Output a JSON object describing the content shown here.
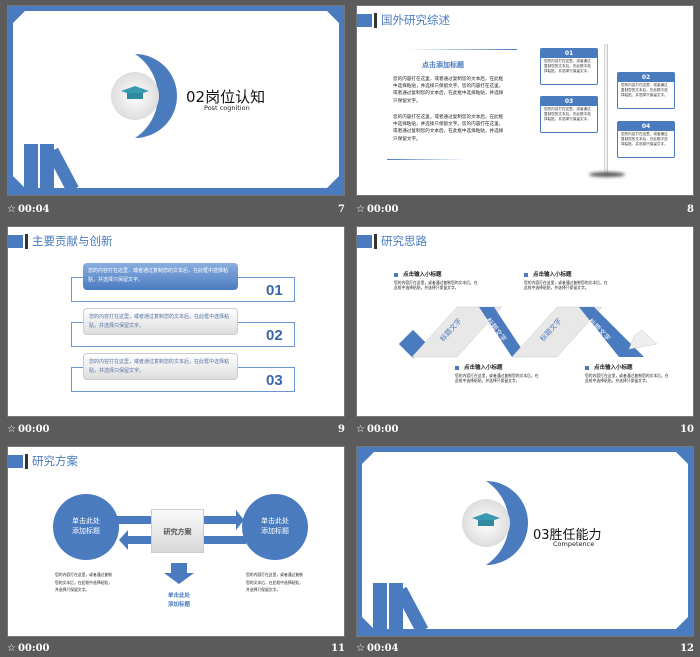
{
  "body_text": "您的内容打在这里，或者通过复制您的文本后，在此框中选择粘贴，并选择只保留文字。",
  "slides": [
    {
      "number": "7",
      "time": "00:04",
      "title": "02岗位认知",
      "subtitle": "Post cognition"
    },
    {
      "number": "8",
      "time": "00:00",
      "title": "国外研究综述",
      "heading": "点击添加标题",
      "para1": "您的内容打在这里，或者通过复制您的文本后，在此框中选择粘贴，并选择只保留文字。您的内容打在这里，或者通过复制您的文本后，在此框中选择粘贴，并选择只保留文字。",
      "para2": "您的内容打在这里，或者通过复制您的文本后，在此框中选择粘贴，并选择只保留文字。您的内容打在这里，或者通过复制您的文本后，在此框中选择粘贴，并选择只保留文字。",
      "items": [
        {
          "num": "01"
        },
        {
          "num": "02"
        },
        {
          "num": "03"
        },
        {
          "num": "04"
        }
      ]
    },
    {
      "number": "9",
      "time": "00:00",
      "title": "主要贡献与创新",
      "rows": [
        {
          "num": "01"
        },
        {
          "num": "02"
        },
        {
          "num": "03"
        }
      ]
    },
    {
      "number": "10",
      "time": "00:00",
      "title": "研究思路",
      "subheading": "点击输入小标题",
      "ribbon_label": "标题文字"
    },
    {
      "number": "11",
      "time": "00:00",
      "title": "研究方案",
      "circle_label_1": "单击此处",
      "circle_label_2": "添加标题",
      "center_label": "研究方案"
    },
    {
      "number": "12",
      "time": "00:04",
      "title": "03胜任能力",
      "subtitle": "Competence"
    }
  ],
  "colors": {
    "accent": "#4a7bbf"
  }
}
